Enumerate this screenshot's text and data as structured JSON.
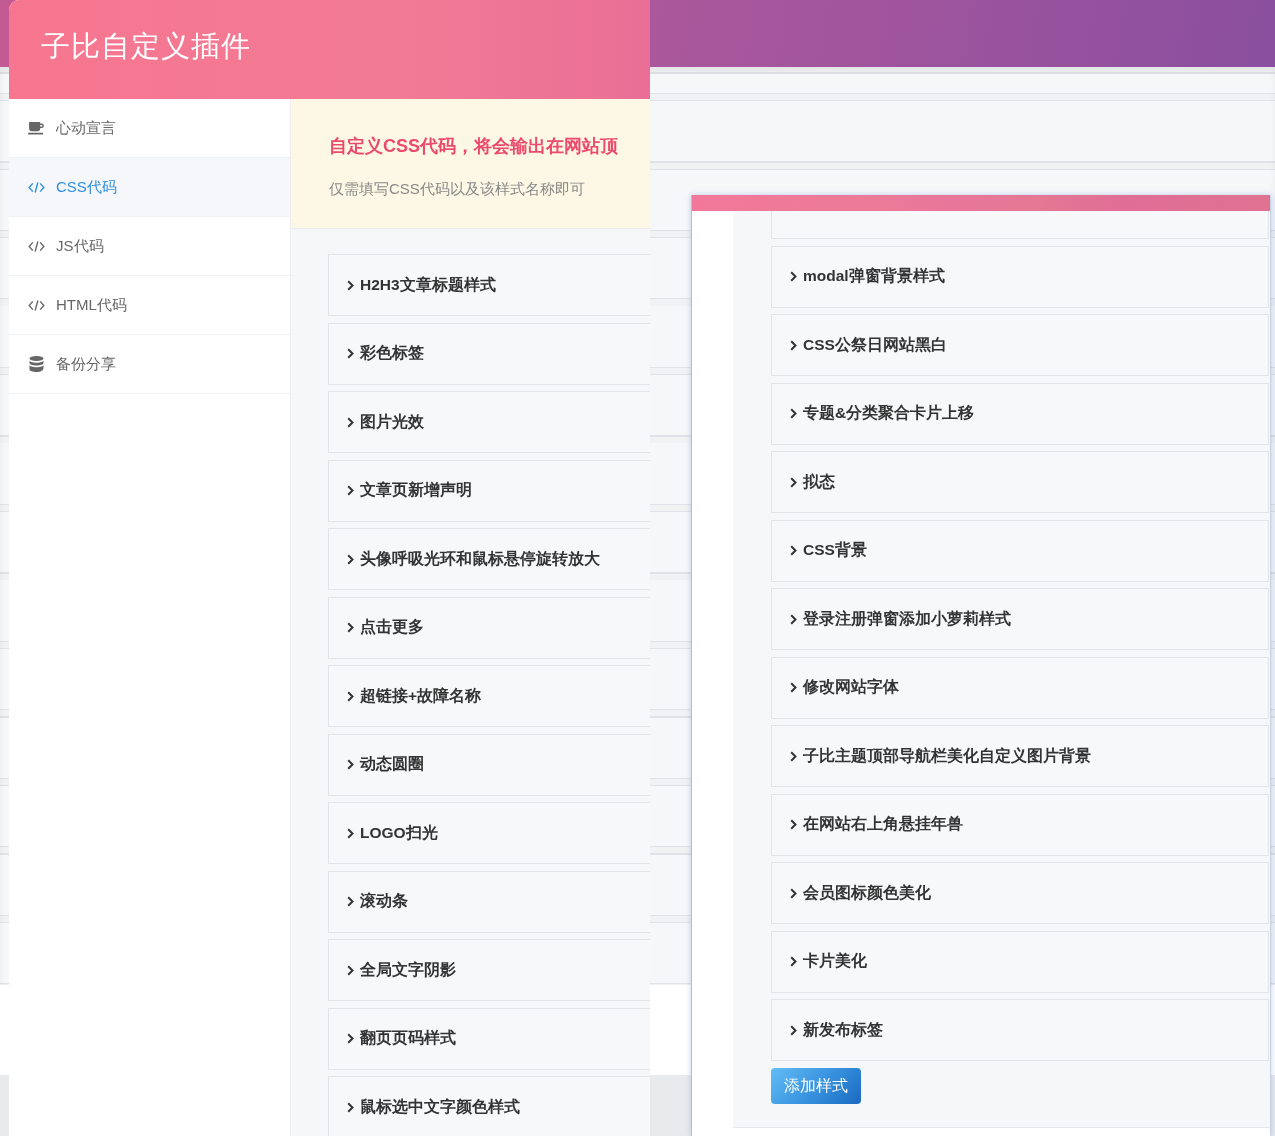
{
  "plugin_panel": {
    "title": "子比自定义插件",
    "sidebar": {
      "items": [
        {
          "label": "心动宣言",
          "kind": "declaration",
          "selected": false
        },
        {
          "label": "CSS代码",
          "kind": "code",
          "selected": true
        },
        {
          "label": "JS代码",
          "kind": "code",
          "selected": false
        },
        {
          "label": "HTML代码",
          "kind": "code",
          "selected": false
        },
        {
          "label": "备份分享",
          "kind": "backup",
          "selected": false
        }
      ]
    },
    "notice": {
      "title": "自定义CSS代码，将会输出在网站顶",
      "text": "仅需填写CSS代码以及该样式名称即可"
    },
    "styles": [
      {
        "label": "H2H3文章标题样式",
        "expanded": false
      },
      {
        "label": "彩色标签",
        "expanded": false
      },
      {
        "label": "图片光效",
        "expanded": false
      },
      {
        "label": "文章页新增声明",
        "expanded": false
      },
      {
        "label": "头像呼吸光环和鼠标悬停旋转放大",
        "expanded": false
      },
      {
        "label": "点击更多",
        "expanded": false
      },
      {
        "label": "超链接+故障名称",
        "expanded": false
      },
      {
        "label": "动态圆圈",
        "expanded": false
      },
      {
        "label": "LOGO扫光",
        "expanded": false
      },
      {
        "label": "滚动条",
        "expanded": false
      },
      {
        "label": "全局文字阴影",
        "expanded": false
      },
      {
        "label": "翻页页码样式",
        "expanded": false
      },
      {
        "label": "鼠标选中文字颜色样式",
        "expanded": false
      }
    ]
  },
  "style_dialog": {
    "styles": [
      {
        "label": "modal弹窗背景样式",
        "expanded": false
      },
      {
        "label": "CSS公祭日网站黑白",
        "expanded": false
      },
      {
        "label": "专题&分类聚合卡片上移",
        "expanded": false
      },
      {
        "label": "拟态",
        "expanded": false
      },
      {
        "label": "CSS背景",
        "expanded": false
      },
      {
        "label": "登录注册弹窗添加小萝莉样式",
        "expanded": false
      },
      {
        "label": "修改网站字体",
        "expanded": false
      },
      {
        "label": "子比主题顶部导航栏美化自定义图片背景",
        "expanded": false
      },
      {
        "label": "在网站右上角悬挂年兽",
        "expanded": false
      },
      {
        "label": "会员图标颜色美化",
        "expanded": false
      },
      {
        "label": "卡片美化",
        "expanded": false
      },
      {
        "label": "新发布标签",
        "expanded": false
      }
    ],
    "add_button": "添加样式"
  }
}
